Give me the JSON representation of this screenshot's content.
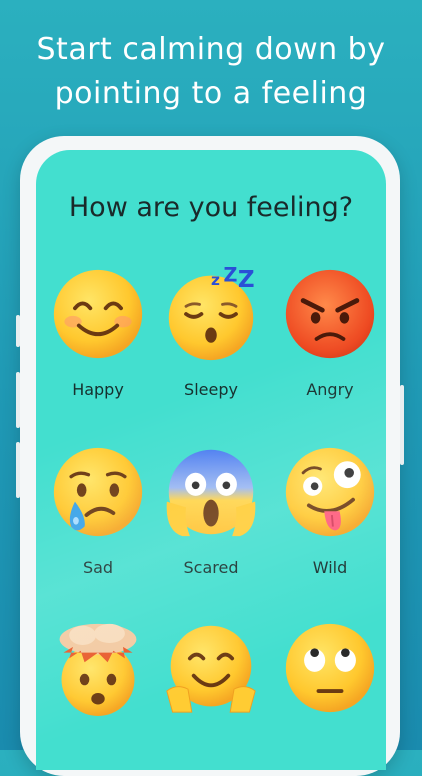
{
  "headline": {
    "line1": "Start calming down by",
    "line2": "pointing to a feeling"
  },
  "app": {
    "question": "How are you feeling?",
    "feelings": [
      {
        "label": "Happy",
        "icon": "smiling-face-icon"
      },
      {
        "label": "Sleepy",
        "icon": "sleeping-face-icon"
      },
      {
        "label": "Angry",
        "icon": "angry-face-icon"
      },
      {
        "label": "Sad",
        "icon": "sad-tear-face-icon"
      },
      {
        "label": "Scared",
        "icon": "screaming-face-icon"
      },
      {
        "label": "Wild",
        "icon": "zany-face-icon"
      },
      {
        "label": "",
        "icon": "exploding-head-icon"
      },
      {
        "label": "",
        "icon": "hugging-face-icon"
      },
      {
        "label": "",
        "icon": "eye-roll-face-icon"
      }
    ]
  },
  "colors": {
    "background": "#1f98b4",
    "screen": "#43dfcf",
    "emoji_yellow": "#ffcc33",
    "angry_red": "#f05a32"
  }
}
